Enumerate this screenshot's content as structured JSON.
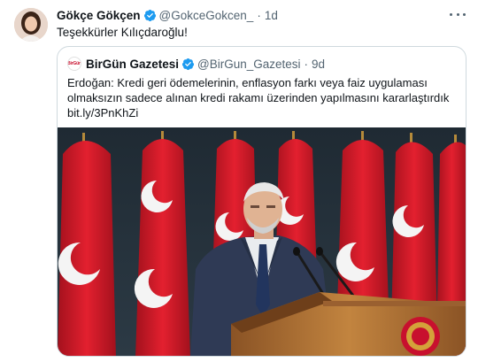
{
  "tweet": {
    "author_name": "Gökçe Gökçen",
    "author_handle": "@GokceGokcen_",
    "time": "1d",
    "text": "Teşekkürler Kılıçdaroğlu!",
    "more_icon": "more-horizontal-icon"
  },
  "quote": {
    "author_name": "BirGün Gazetesi",
    "author_handle": "@BirGun_Gazetesi",
    "time": "9d",
    "avatar_text": "BirGün",
    "text_lines": [
      "Erdoğan: Kredi geri ödemelerinin, enflasyon farkı veya faiz uygulaması",
      "olmaksızın sadece alınan kredi rakamı üzerinden yapılmasını kararlaştırdık",
      "bit.ly/3PnKhZi"
    ]
  },
  "colors": {
    "verified": "#1d9bf0",
    "muted": "#536471",
    "flag_red": "#d61a2a",
    "podium": "#b8773a"
  }
}
